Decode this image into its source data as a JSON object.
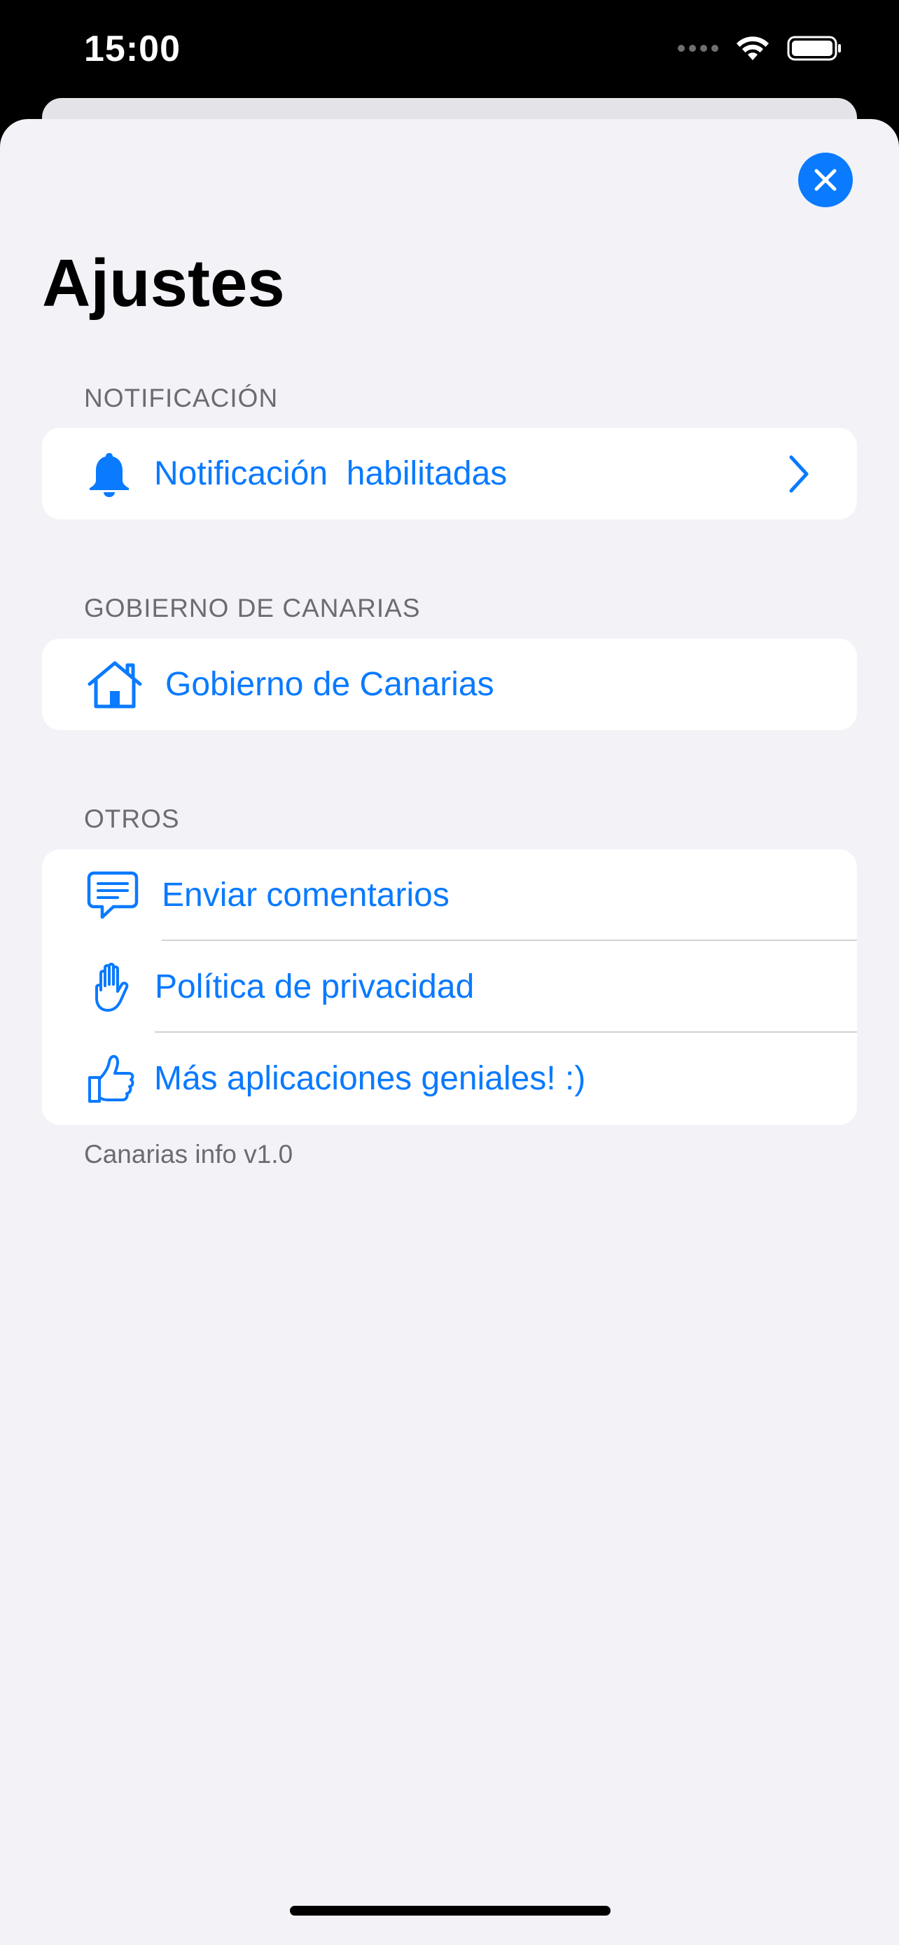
{
  "status_bar": {
    "time": "15:00"
  },
  "page": {
    "title": "Ajustes",
    "close_icon": "close-icon"
  },
  "sections": {
    "notificacion": {
      "header": "NOTIFICACIÓN",
      "items": [
        {
          "label": "Notificación  habilitadas",
          "icon": "bell-icon",
          "accessory": "chevron-right-icon"
        }
      ]
    },
    "gobierno": {
      "header": "GOBIERNO DE CANARIAS",
      "items": [
        {
          "label": "Gobierno de Canarias",
          "icon": "house-icon"
        }
      ]
    },
    "otros": {
      "header": "OTROS",
      "items": [
        {
          "label": "Enviar comentarios",
          "icon": "message-bubble-icon"
        },
        {
          "label": "Política de privacidad",
          "icon": "hand-raised-icon"
        },
        {
          "label": "Más aplicaciones geniales! :)",
          "icon": "thumbs-up-icon"
        }
      ]
    }
  },
  "footer": {
    "version": "Canarias info v1.0"
  },
  "colors": {
    "accent": "#0a7aff",
    "background": "#f2f2f7",
    "secondary_text": "#6c6c70"
  }
}
